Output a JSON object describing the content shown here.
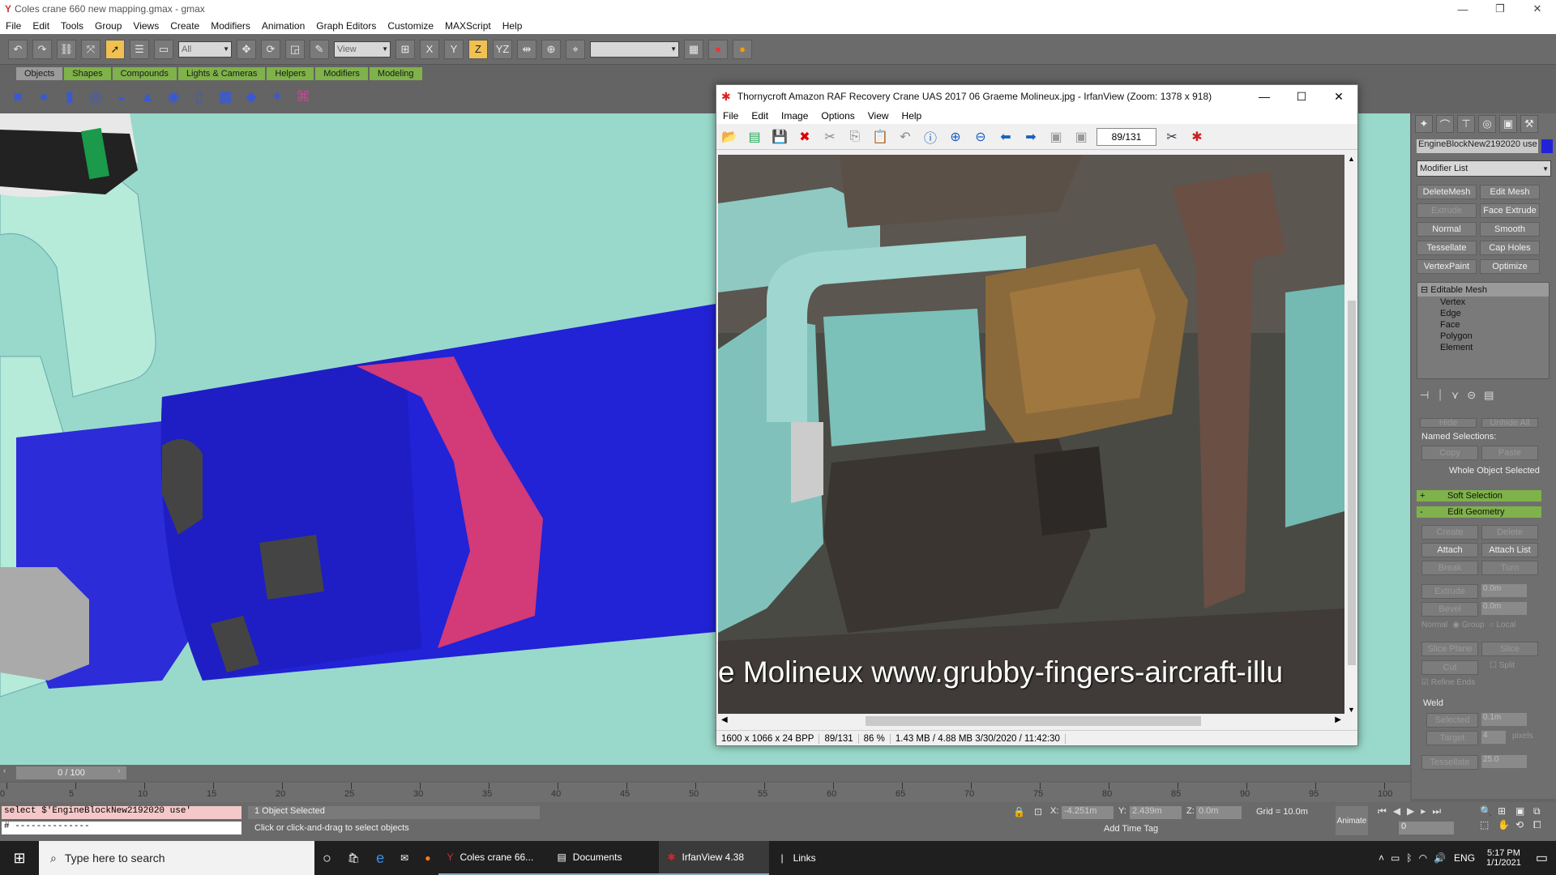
{
  "gmax": {
    "title": "Coles crane 660 new mapping.gmax - gmax",
    "menu": [
      "File",
      "Edit",
      "Tools",
      "Group",
      "Views",
      "Create",
      "Modifiers",
      "Animation",
      "Graph Editors",
      "Customize",
      "MAXScript",
      "Help"
    ],
    "selection_filter": "All",
    "ref_coord": "View",
    "tabs": [
      "Objects",
      "Shapes",
      "Compounds",
      "Lights & Cameras",
      "Helpers",
      "Modifiers",
      "Modeling"
    ]
  },
  "irfan": {
    "title": "Thornycroft Amazon RAF Recovery Crane UAS 2017 06 Graeme Molineux.jpg - IrfanView (Zoom: 1378 x 918)",
    "menu": [
      "File",
      "Edit",
      "Image",
      "Options",
      "View",
      "Help"
    ],
    "page": "89/131",
    "watermark": "e Molineux www.grubby-fingers-aircraft-illu",
    "status": [
      "1600 x 1066 x 24 BPP",
      "89/131",
      "86 %",
      "1.43 MB / 4.88 MB 3/30/2020 / 11:42:30"
    ]
  },
  "panel": {
    "object_name": "EngineBlockNew2192020 use",
    "modifier_list": "Modifier List",
    "buttons": [
      [
        "DeleteMesh",
        "Edit Mesh"
      ],
      [
        "Extrude",
        "Face Extrude"
      ],
      [
        "Normal",
        "Smooth"
      ],
      [
        "Tessellate",
        "Cap Holes"
      ],
      [
        "VertexPaint",
        "Optimize"
      ]
    ],
    "stack_title": "Editable Mesh",
    "stack_items": [
      "Vertex",
      "Edge",
      "Face",
      "Polygon",
      "Element"
    ],
    "named_selections": "Named Selections:",
    "copy": "Copy",
    "paste": "Paste",
    "whole_object": "Whole Object Selected",
    "soft_selection": "Soft Selection",
    "edit_geometry": "Edit Geometry",
    "geo_buttons": [
      [
        "Create",
        "Delete"
      ],
      [
        "Attach",
        "Attach List"
      ],
      [
        "Break",
        "Turn"
      ]
    ],
    "extrude": "Extrude",
    "bevel": "Bevel",
    "extrude_val": "0.0m",
    "bevel_val": "0.0m",
    "slice_plane": "Slice Plane",
    "slice": "Slice",
    "cut": "Cut",
    "split": "Split",
    "refine_ends": "Refine Ends",
    "weld": "Weld",
    "selected": "Selected",
    "weld_val": "0.1m",
    "target": "Target",
    "target_val": "4",
    "pixels": "pixels",
    "tessellate": "Tessellate",
    "tess_val": "25.0",
    "normal_label": "Normal",
    "group": "Group",
    "local": "Local",
    "hide": "Hide",
    "unhide_all": "Unhide All"
  },
  "timeline": {
    "frame": "0 / 100",
    "ticks": [
      "0",
      "5",
      "10",
      "15",
      "20",
      "25",
      "30",
      "35",
      "40",
      "45",
      "50",
      "55",
      "60",
      "65",
      "70",
      "75",
      "80",
      "85",
      "90",
      "95",
      "100"
    ]
  },
  "status": {
    "script": "select $'EngineBlockNew2192020 use'",
    "script2": "# --------------",
    "selected": "1 Object Selected",
    "prompt": "Click or click-and-drag to select objects",
    "x": "-4.251m",
    "y": "2.439m",
    "z": "0.0m",
    "grid": "Grid = 10.0m",
    "add_time_tag": "Add Time Tag",
    "animate": "Animate",
    "frame_box": "0"
  },
  "taskbar": {
    "search": "Type here to search",
    "apps": [
      "Coles crane 66...",
      "Documents",
      "IrfanView 4.38"
    ],
    "links": "Links",
    "lang": "ENG",
    "time": "5:17 PM",
    "date": "1/1/2021"
  }
}
